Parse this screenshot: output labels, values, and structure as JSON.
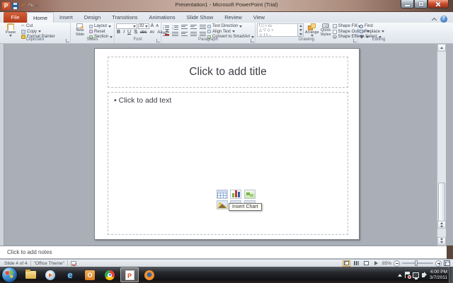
{
  "window": {
    "title": "Presentation1 - Microsoft PowerPoint (Trial)"
  },
  "tabs": [
    "File",
    "Home",
    "Insert",
    "Design",
    "Transitions",
    "Animations",
    "Slide Show",
    "Review",
    "View"
  ],
  "ribbon": {
    "clipboard": {
      "label": "Clipboard",
      "paste": "Paste",
      "cut": "Cut",
      "copy": "Copy",
      "format_painter": "Format Painter"
    },
    "slides": {
      "label": "Slides",
      "new_line1": "New",
      "new_line2": "Slide",
      "layout": "Layout",
      "reset": "Reset",
      "section": "Section"
    },
    "font": {
      "label": "Font",
      "size": "32",
      "bold": "B",
      "italic": "I",
      "underline": "U",
      "strike": "abc",
      "shadow": "S",
      "spacing": "AV",
      "case": "Aa",
      "color": "A",
      "grow": "A",
      "shrink": "A"
    },
    "paragraph": {
      "label": "Paragraph",
      "text_direction": "Text Direction",
      "align_text": "Align Text",
      "smartart": "Convert to SmartArt"
    },
    "drawing": {
      "label": "Drawing",
      "arrange": "Arrange",
      "quick1": "Quick",
      "quick2": "Styles",
      "fill": "Shape Fill",
      "outline": "Shape Outline",
      "effects": "Shape Effects"
    },
    "editing": {
      "label": "Editing",
      "find": "Find",
      "replace": "Replace",
      "select": "Select"
    }
  },
  "icons": {
    "scissors": "✂",
    "undo": "↶",
    "redo": "↷",
    "help": "?",
    "ie": "e",
    "outlook": "O",
    "ppt": "P",
    "shapes_r1": "\\ □ ○ ▭",
    "shapes_r2": "△ ▽ ◇ ○",
    "shapes_r3": "☆ ( ) ←"
  },
  "slide": {
    "title_placeholder": "Click to add title",
    "bullet": "•",
    "body_placeholder": "Click to add text",
    "tooltip": "Insert Chart"
  },
  "notes": {
    "placeholder": "Click to add notes"
  },
  "status": {
    "slide_counter": "Slide 4 of 4",
    "theme": "\"Office Theme\"",
    "zoom": "85%"
  },
  "tray": {
    "time": "4:00 PM",
    "date": "3/7/2011"
  },
  "colors": {
    "file_tab": "#c2411d",
    "titlebar_glass": "#c4aa9d",
    "canvas_gray": "#a9aeb7",
    "close_button": "#ce4f2f"
  }
}
